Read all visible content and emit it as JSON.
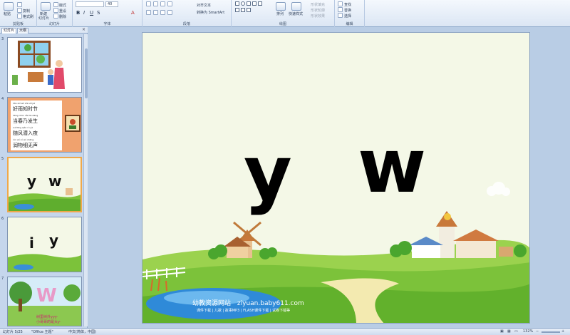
{
  "ribbon": {
    "groups": [
      "剪贴板",
      "幻灯片",
      "字体",
      "段落",
      "绘图",
      "编辑"
    ],
    "clipboard": {
      "paste": "粘贴",
      "copy": "复制",
      "format_painter": "格式刷"
    },
    "slides": {
      "new_slide": "新建",
      "new_slide_2": "幻灯片",
      "layout": "版式",
      "reset": "重设",
      "delete": "删除"
    },
    "font": {
      "size": "40"
    },
    "paragraph": {
      "align_text": "对齐文本",
      "convert_smartart": "转换为 SmartArt"
    },
    "drawing": {
      "arrange": "排列",
      "quick_styles": "快速样式",
      "fill": "形状填充",
      "outline": "形状轮廓",
      "effects": "形状效果"
    },
    "editing": {
      "find": "查找",
      "replace": "替换",
      "select": "选择"
    }
  },
  "panel": {
    "tabs": [
      "幻灯片",
      "大纲"
    ],
    "close": "×",
    "slides": [
      {
        "num": "3"
      },
      {
        "num": "4",
        "pinyin": [
          "hǎo shí wǒ zhī shí jié",
          "dāng chūn nǎi fā shēng",
          "suí fēng qián rù yè",
          "rùn wù xì wú shēng"
        ],
        "hanzi": [
          "好雨知时节",
          "当春乃发生",
          "随风潜入夜",
          "润物细无声"
        ]
      },
      {
        "num": "5",
        "letters": [
          "y",
          "w"
        ]
      },
      {
        "num": "6",
        "letters": [
          "i",
          "y"
        ]
      },
      {
        "num": "7",
        "caption": "树里树外yyy·",
        "caption2": "小哥哥的是大y·"
      }
    ]
  },
  "slide": {
    "letters": [
      "y",
      "w"
    ],
    "site_name": "幼教资源网站",
    "site_url": "ziyuan.baby611.com",
    "site_sub": "课件下载 | 儿歌 | 故事MP3 | FLASH课件下载 | 试卷下载等"
  },
  "status": {
    "slide_of": "幻灯片 5/25",
    "theme": "\"Office 主题\"",
    "language": "中文(简体，中国)",
    "zoom": "132%"
  },
  "colors": {
    "accent": "#f0a84a",
    "sky": "#f4f8e7",
    "grass": "#7cc23a"
  }
}
